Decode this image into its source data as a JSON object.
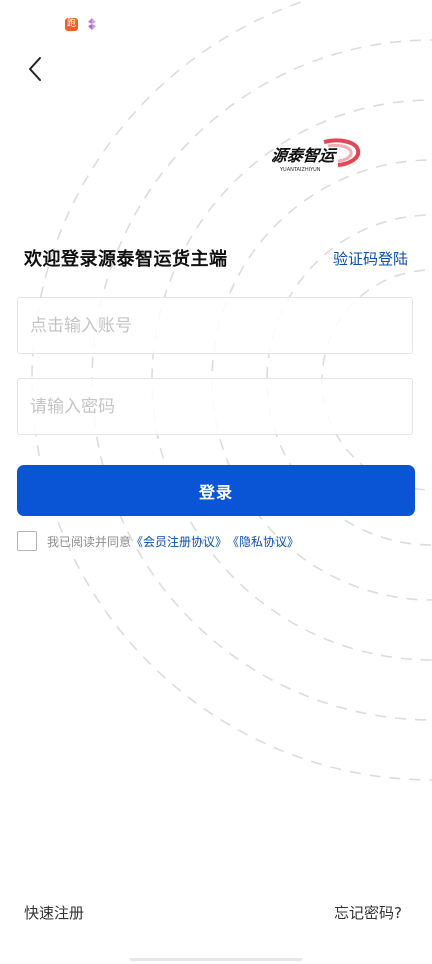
{
  "status_bar": {
    "icon_a": "app-notification-icon",
    "icon_a_glyph": "跑",
    "icon_b": "pinwheel-icon"
  },
  "header": {
    "back_icon": "chevron-left-icon"
  },
  "logo": {
    "brand_name": "源泰智运",
    "brand_pinyin": "YUANTAIZHIYUN"
  },
  "login": {
    "title": "欢迎登录源泰智运货主端",
    "sms_login_link": "验证码登陆",
    "account_placeholder": "点击输入账号",
    "account_value": "",
    "password_placeholder": "请输入密码",
    "password_value": "",
    "submit_label": "登录"
  },
  "agreement": {
    "checked": false,
    "prefix": "我已阅读并同意",
    "member_agreement": "《会员注册协议》",
    "privacy_agreement": "《隐私协议》"
  },
  "footer": {
    "quick_register": "快速注册",
    "forgot_password": "忘记密码?"
  },
  "colors": {
    "primary": "#0a55d6",
    "link": "#0a4fa8",
    "brand_red": "#d9283a"
  }
}
